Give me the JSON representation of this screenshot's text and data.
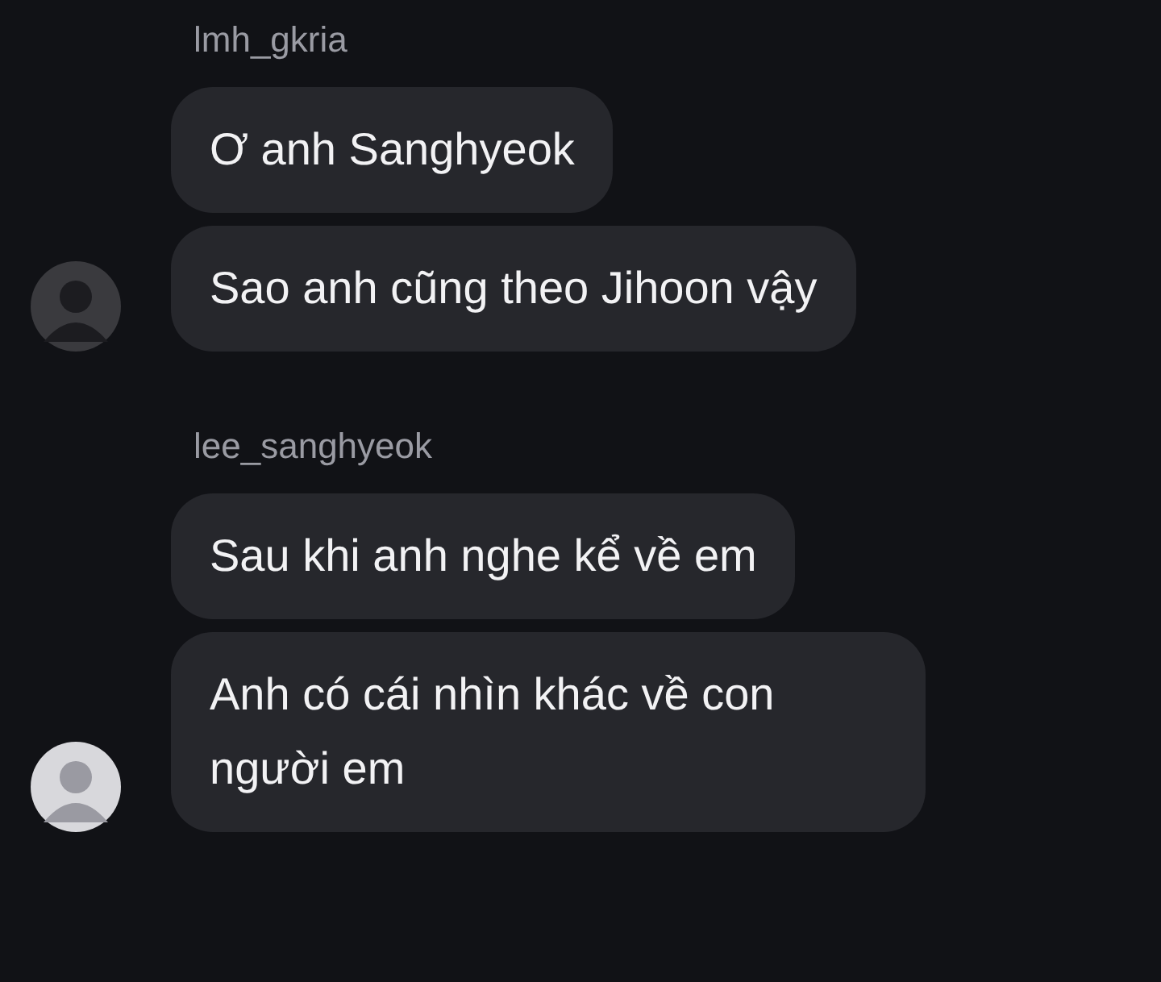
{
  "groups": [
    {
      "username": "lmh_gkria",
      "messages": [
        "Ơ anh Sanghyeok",
        "Sao anh cũng theo Jihoon vậy"
      ]
    },
    {
      "username": "lee_sanghyeok",
      "messages": [
        "Sau khi anh nghe kể về em",
        "Anh có cái nhìn khác về con người em"
      ]
    }
  ]
}
